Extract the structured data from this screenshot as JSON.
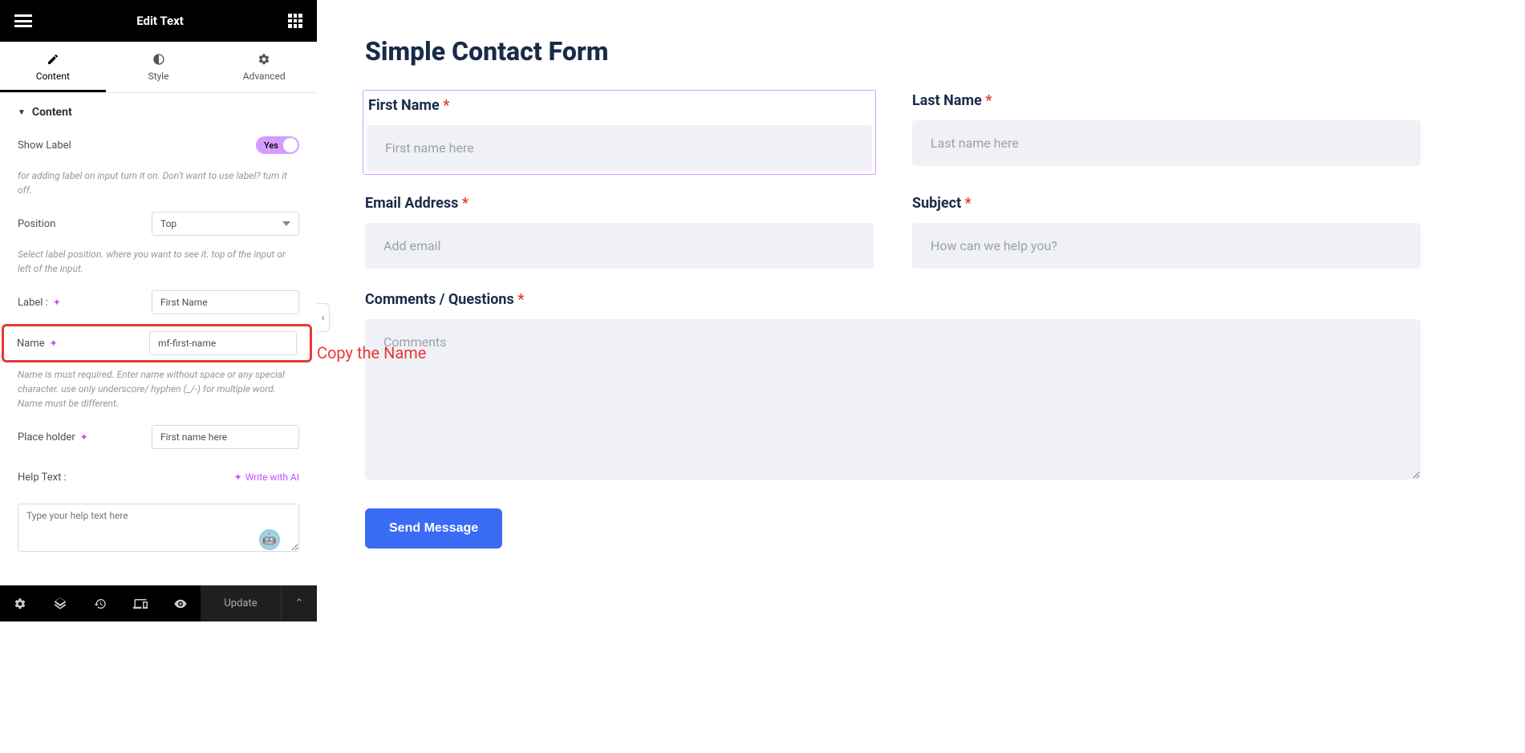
{
  "header": {
    "title": "Edit Text"
  },
  "tabs": {
    "content": "Content",
    "style": "Style",
    "advanced": "Advanced"
  },
  "section": {
    "title": "Content"
  },
  "controls": {
    "show_label": {
      "label": "Show Label",
      "value": "Yes",
      "help": "for adding label on input turn it on. Don't want to use label? turn it off."
    },
    "position": {
      "label": "Position",
      "value": "Top",
      "help": "Select label position. where you want to see it. top of the input or left of the input."
    },
    "label": {
      "label": "Label :",
      "value": "First Name"
    },
    "name": {
      "label": "Name",
      "value": "mf-first-name",
      "help": "Name is must required. Enter name without space or any special character. use only underscore/ hyphen (_/-) for multiple word. Name must be different."
    },
    "placeholder": {
      "label": "Place holder",
      "value": "First name here"
    },
    "help_text": {
      "label": "Help Text :",
      "write_ai": "Write with AI",
      "placeholder": "Type your help text here"
    }
  },
  "annotation": "Copy the Name",
  "footer": {
    "update": "Update"
  },
  "preview": {
    "title": "Simple Contact Form",
    "fields": {
      "first_name": {
        "label": "First Name",
        "placeholder": "First name here"
      },
      "last_name": {
        "label": "Last Name",
        "placeholder": "Last name here"
      },
      "email": {
        "label": "Email Address",
        "placeholder": "Add email"
      },
      "subject": {
        "label": "Subject",
        "placeholder": "How can we help you?"
      },
      "comments": {
        "label": "Comments / Questions",
        "placeholder": "Comments"
      }
    },
    "submit": "Send Message"
  }
}
